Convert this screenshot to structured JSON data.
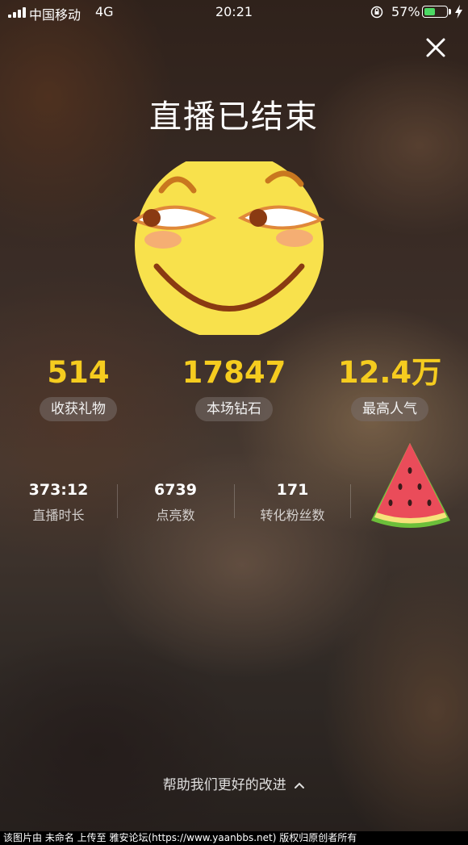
{
  "status_bar": {
    "carrier": "中国移动",
    "network": "4G",
    "time": "20:21",
    "battery_percent": "57%",
    "battery_level": 0.57
  },
  "page": {
    "title": "直播已结束",
    "close_icon": "close-icon",
    "emoji_icon": "smirk-face-emoji",
    "gift_icon": "watermelon-icon"
  },
  "top_stats": [
    {
      "value": "514",
      "label": "收获礼物"
    },
    {
      "value": "17847",
      "label": "本场钻石"
    },
    {
      "value": "12.4万",
      "label": "最高人气"
    }
  ],
  "small_stats": [
    {
      "value": "373:12",
      "label": "直播时长"
    },
    {
      "value": "6739",
      "label": "点亮数"
    },
    {
      "value": "171",
      "label": "转化粉丝数"
    }
  ],
  "feedback": {
    "label": "帮助我们更好的改进",
    "icon": "chevron-up-icon"
  },
  "footer": {
    "text": "该图片由 未命名 上传至 雅安论坛(https://www.yaanbbs.net) 版权归原创者所有"
  },
  "colors": {
    "accent_yellow": "#f5cc1f",
    "battery_green": "#4cd964"
  }
}
